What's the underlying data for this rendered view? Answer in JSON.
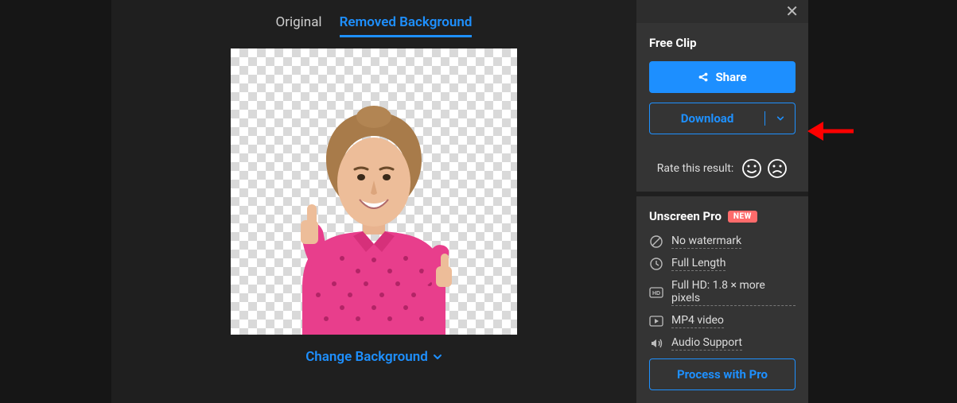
{
  "tabs": {
    "original": "Original",
    "removed": "Removed Background"
  },
  "change_background": "Change Background",
  "sidebar": {
    "free_clip": "Free Clip",
    "share": "Share",
    "download": "Download",
    "rate_label": "Rate this result:",
    "pro_title": "Unscreen Pro",
    "new_badge": "NEW",
    "features": {
      "no_watermark": "No watermark",
      "full_length": "Full Length",
      "full_hd": "Full HD: 1.8 × more pixels",
      "mp4": "MP4 video",
      "audio": "Audio Support"
    },
    "process_pro": "Process with Pro"
  }
}
